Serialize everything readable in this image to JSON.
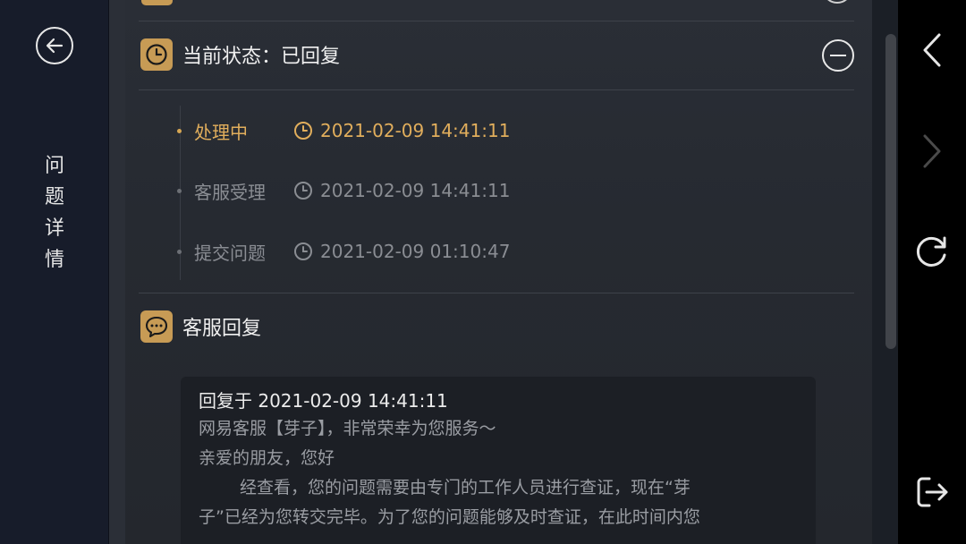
{
  "sidebar": {
    "title": "问题详情"
  },
  "status_section": {
    "title": "当前状态：已回复",
    "timeline": [
      {
        "label": "处理中",
        "time": "2021-02-09 14:41:11",
        "active": true
      },
      {
        "label": "客服受理",
        "time": "2021-02-09 14:41:11",
        "active": false
      },
      {
        "label": "提交问题",
        "time": "2021-02-09 01:10:47",
        "active": false
      }
    ]
  },
  "reply_section": {
    "title": "客服回复",
    "reply_header": "回复于 2021-02-09 14:41:11",
    "lines": [
      "网易客服【芽子】，非常荣幸为您服务～",
      "亲爱的朋友，您好",
      "经查看，您的问题需要由专门的工作人员进行查证，现在“芽",
      "子”已经为您转交完毕。为了您的问题能够及时查证，在此时间内您"
    ]
  },
  "icons": {
    "back": "back-arrow-circle-icon",
    "clock": "clock-icon",
    "chat": "chat-bubble-icon",
    "collapse": "minus-circle-icon",
    "nav_back": "chevron-left-icon",
    "nav_forward": "chevron-right-icon",
    "refresh": "refresh-icon",
    "exit": "exit-icon"
  },
  "colors": {
    "accent_gold": "#c79b55",
    "active_text": "#e1ae5c",
    "inactive_text": "#8a8d93"
  }
}
